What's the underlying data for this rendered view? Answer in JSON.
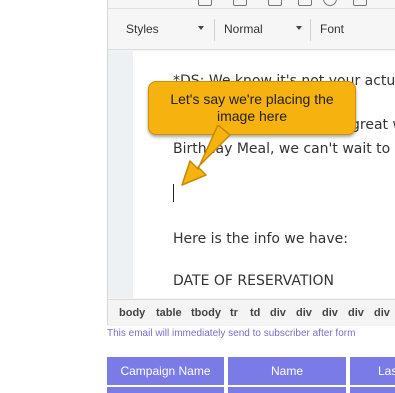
{
  "toolbar": {
    "styles_label": "Styles",
    "format_label": "Normal",
    "font_label": "Font"
  },
  "document": {
    "line1": "*DS: We know it's not your actu",
    "line2": "great w",
    "line3": "Birthday Meal, we can't wait to",
    "line4": "Here is the info we have:",
    "line5": "DATE OF RESERVATION"
  },
  "callout": {
    "text": "Let's say we're placing the image here",
    "color": "#f6b20e"
  },
  "pathbar": {
    "items": [
      "body",
      "table",
      "tbody",
      "tr",
      "td",
      "div",
      "div",
      "div",
      "div",
      "div"
    ]
  },
  "notice": "This email will immediately send to subscriber after form",
  "table": {
    "headers": [
      "Campaign Name",
      "Name",
      "Las"
    ],
    "header_color": "#7b7be8"
  }
}
